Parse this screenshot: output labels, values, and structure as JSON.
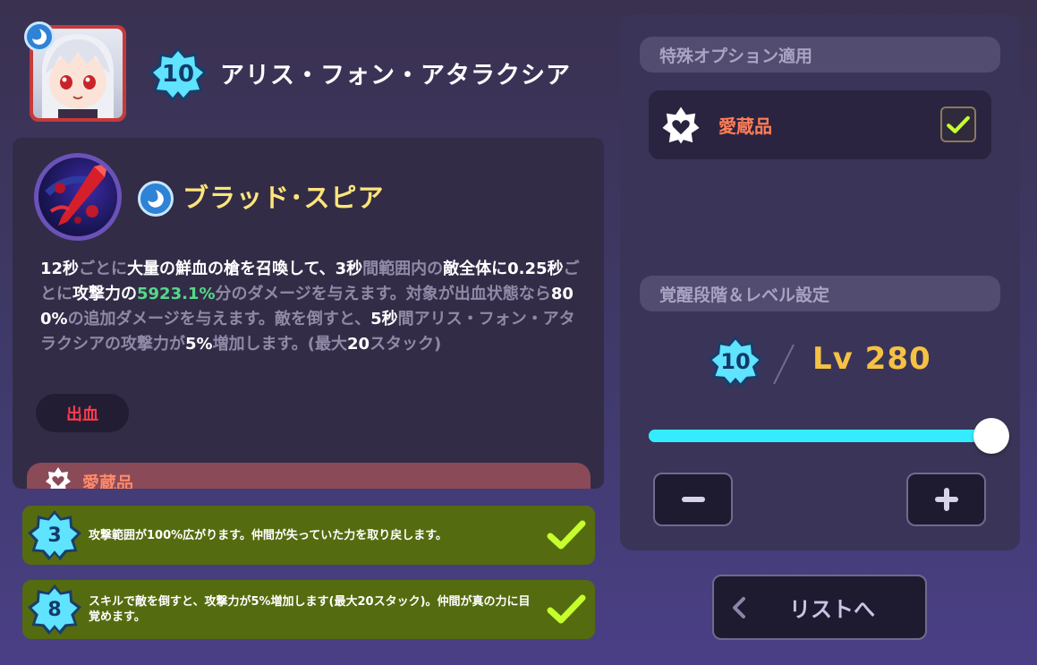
{
  "character": {
    "name": "アリス・フォン・アタラクシア",
    "awakening": "10",
    "portrait_icon": "character-portrait",
    "element_icon": "water-element-icon"
  },
  "skill": {
    "name": "ブラッド･スピア",
    "icon": "blood-spear-skill-icon",
    "element_icon": "water-element-icon",
    "description_parts": [
      {
        "t": "12秒",
        "s": "b"
      },
      {
        "t": "ごとに",
        "s": "n"
      },
      {
        "t": "大量の鮮血の槍を召喚して、",
        "s": "b"
      },
      {
        "t": "3秒",
        "s": "b"
      },
      {
        "t": "間範囲内の",
        "s": "n"
      },
      {
        "t": "敵全体に",
        "s": "b"
      },
      {
        "t": "0.25秒",
        "s": "b"
      },
      {
        "t": "ごとに",
        "s": "n"
      },
      {
        "t": "攻撃力の",
        "s": "b"
      },
      {
        "t": "5923.1%",
        "s": "g"
      },
      {
        "t": "分のダメージを与えます。対象が出血状態なら",
        "s": "n"
      },
      {
        "t": "800%",
        "s": "b"
      },
      {
        "t": "の追加ダメージを与えます。敵を倒すと、",
        "s": "n"
      },
      {
        "t": "5秒",
        "s": "b"
      },
      {
        "t": "間アリス・フォン・アタラクシアの攻撃力が",
        "s": "n"
      },
      {
        "t": "5%",
        "s": "b"
      },
      {
        "t": "増加します。(最大",
        "s": "n"
      },
      {
        "t": "20",
        "s": "b"
      },
      {
        "t": "スタック)",
        "s": "n"
      }
    ],
    "tag": "出血",
    "treasure_label": "愛蔵品"
  },
  "bonuses": [
    {
      "level": "3",
      "text": "攻撃範囲が100%広がります。仲間が失っていた力を取り戻します。",
      "checked": true
    },
    {
      "level": "8",
      "text": "スキルで敵を倒すと、攻撃力が5%増加します(最大20スタック)。仲間が真の力に目覚めます。",
      "checked": true
    }
  ],
  "right_panel": {
    "special_option_header": "特殊オプション適用",
    "option_label": "愛蔵品",
    "option_checked": true,
    "level_header": "覚醒段階＆レベル設定",
    "awakening": "10",
    "level_text": "Lv 280",
    "slider_fraction": 1.0
  },
  "list_button": {
    "label": "リストへ",
    "icon": "chevron-left-icon"
  },
  "colors": {
    "accent_cyan": "#34ecff",
    "gold": "#f6c244",
    "bonus_green": "#556b10",
    "check_green": "#c6ff2e",
    "treasure_orange": "#ff7e58",
    "bleed_red": "#ff3b4d"
  }
}
